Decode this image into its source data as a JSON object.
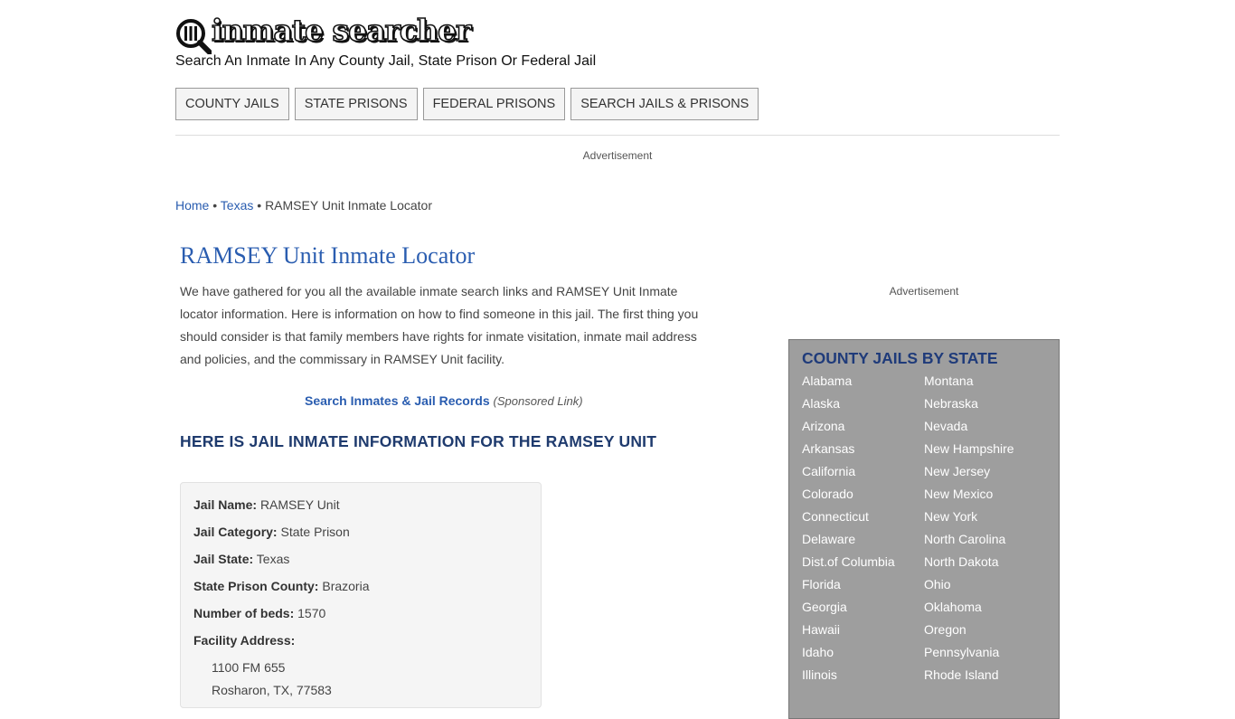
{
  "header": {
    "logo_text": "inmate searcher",
    "tagline": "Search An Inmate In Any County Jail, State Prison Or Federal Jail"
  },
  "nav": [
    {
      "label": "COUNTY JAILS"
    },
    {
      "label": "STATE PRISONS"
    },
    {
      "label": "FEDERAL PRISONS"
    },
    {
      "label": "SEARCH JAILS & PRISONS"
    }
  ],
  "ad_label": "Advertisement",
  "breadcrumb": {
    "home": "Home",
    "sep": "•",
    "state": "Texas",
    "current": "RAMSEY Unit Inmate Locator"
  },
  "main": {
    "title": "RAMSEY Unit Inmate Locator",
    "intro": "We have gathered for you all the available inmate search links and RAMSEY Unit Inmate locator information. Here is information on how to find someone in this jail. The first thing you should consider is that family members have rights for inmate visitation, inmate mail address and policies, and the commissary in RAMSEY Unit facility.",
    "sponsor_link": "Search Inmates & Jail Records",
    "sponsor_note": "(Sponsored Link)",
    "section_heading": "HERE IS JAIL INMATE INFORMATION FOR THE RAMSEY UNIT"
  },
  "info": {
    "jail_name_label": "Jail Name:",
    "jail_name": "RAMSEY Unit",
    "category_label": "Jail Category:",
    "category": "State Prison",
    "state_label": "Jail State:",
    "state": "Texas",
    "county_label": "State Prison County:",
    "county": "Brazoria",
    "beds_label": "Number of beds:",
    "beds": "1570",
    "address_label": "Facility Address:",
    "address_line1": "1100 FM 655",
    "address_line2": "Rosharon, TX, 77583"
  },
  "sidebar": {
    "ad_label": "Advertisement",
    "title": "COUNTY JAILS BY STATE",
    "col1": [
      "Alabama",
      "Alaska",
      "Arizona",
      "Arkansas",
      "California",
      "Colorado",
      "Connecticut",
      "Delaware",
      "Dist.of Columbia",
      "Florida",
      "Georgia",
      "Hawaii",
      "Idaho",
      "Illinois"
    ],
    "col2": [
      "Montana",
      "Nebraska",
      "Nevada",
      "New Hampshire",
      "New Jersey",
      "New Mexico",
      "New York",
      "North Carolina",
      "North Dakota",
      "Ohio",
      "Oklahoma",
      "Oregon",
      "Pennsylvania",
      "Rhode Island"
    ]
  }
}
